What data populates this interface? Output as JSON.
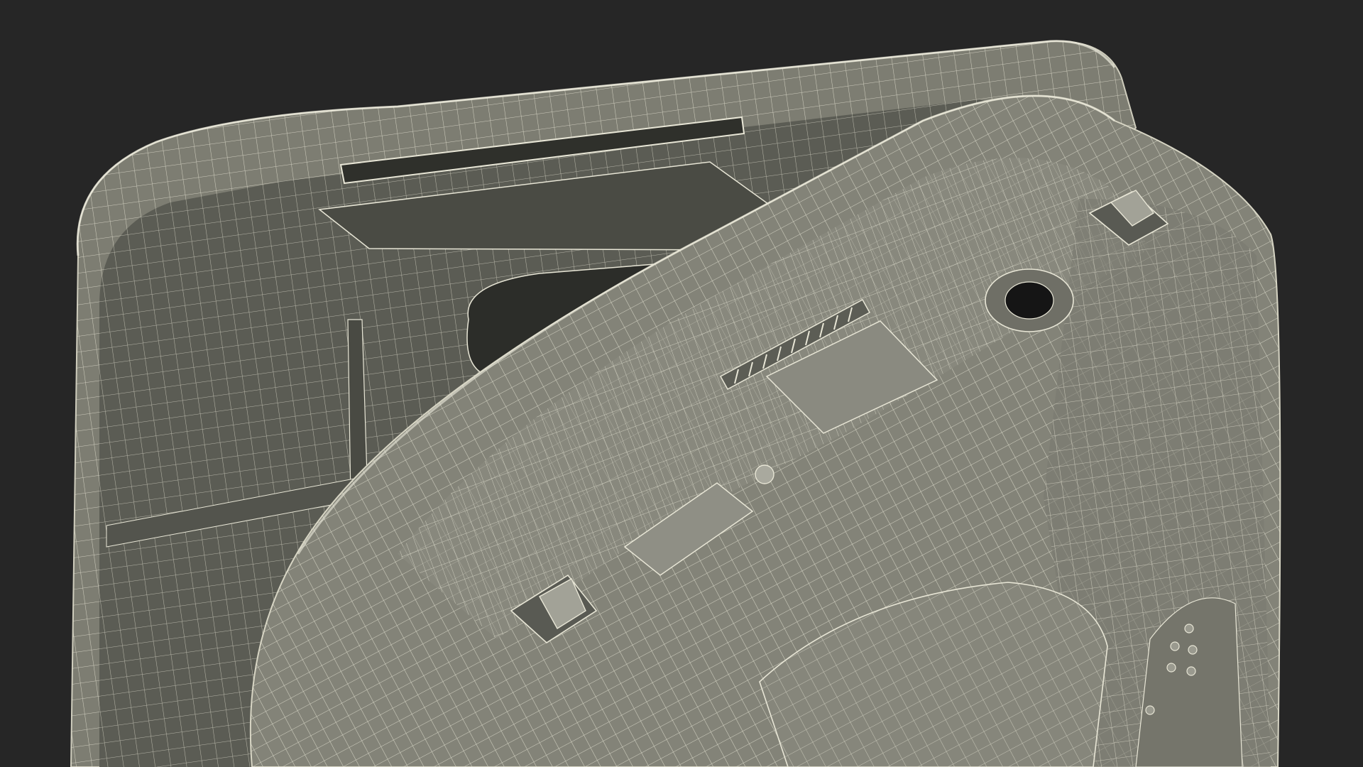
{
  "scene": {
    "subject": "wireframe-3d-render",
    "colors": {
      "background": "#262626",
      "shell_fill": "#7d7d72",
      "shell_dark": "#4e4f48",
      "cavity": "#3a3b36",
      "wire": "#e8e6d6",
      "wire_dim": "#c9c7b6"
    }
  }
}
